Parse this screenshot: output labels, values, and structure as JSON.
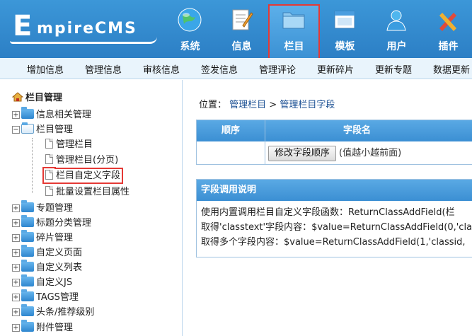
{
  "logo": {
    "letter": "E",
    "rest": "mpireCMS"
  },
  "nav": [
    {
      "label": "系统",
      "icon": "globe-icon"
    },
    {
      "label": "信息",
      "icon": "notepad-icon"
    },
    {
      "label": "栏目",
      "icon": "folder-icon",
      "active": true
    },
    {
      "label": "模板",
      "icon": "window-icon"
    },
    {
      "label": "用户",
      "icon": "user-icon"
    },
    {
      "label": "插件",
      "icon": "tools-icon"
    }
  ],
  "submenu": [
    "增加信息",
    "管理信息",
    "审核信息",
    "签发信息",
    "管理评论",
    "更新碎片",
    "更新专题",
    "数据更新"
  ],
  "sidebar": {
    "root": "栏目管理",
    "items": [
      "信息相关管理",
      "栏目管理",
      "专题管理",
      "标题分类管理",
      "碎片管理",
      "自定义页面",
      "自定义列表",
      "自定义JS",
      "TAGS管理",
      "头条/推荐级别",
      "附件管理"
    ],
    "children": [
      "管理栏目",
      "管理栏目(分页)",
      "栏目自定义字段",
      "批量设置栏目属性"
    ]
  },
  "main": {
    "crumb_prefix": "位置：",
    "crumb_link1": "管理栏目",
    "crumb_sep": " > ",
    "crumb_link2": "管理栏目字段",
    "table": {
      "col1": "顺序",
      "col2": "字段名",
      "button": "修改字段顺序",
      "hint": "(值越小越前面)"
    },
    "usage": {
      "title": "字段调用说明",
      "lines": [
        "使用内置调用栏目自定义字段函数：ReturnClassAddField(栏",
        "取得'classtext'字段内容：$value=ReturnClassAddField(0,'cla",
        "取得多个字段内容：$value=ReturnClassAddField(1,'classid,"
      ]
    }
  },
  "colors": {
    "header": "#2c7fc5",
    "highlight": "#e53935",
    "submenu_bg": "#e9f4fc"
  }
}
